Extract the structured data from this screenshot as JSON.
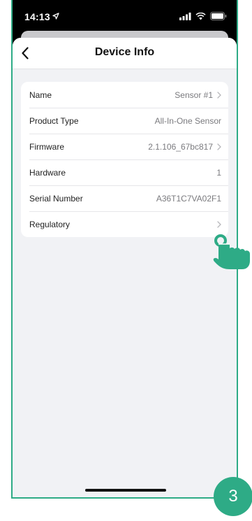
{
  "status_bar": {
    "time": "14:13"
  },
  "nav": {
    "title": "Device Info"
  },
  "rows": [
    {
      "label": "Name",
      "value": "Sensor #1",
      "chevron": true
    },
    {
      "label": "Product Type",
      "value": "All-In-One Sensor",
      "chevron": false
    },
    {
      "label": "Firmware",
      "value": "2.1.106_67bc817",
      "chevron": true
    },
    {
      "label": "Hardware",
      "value": "1",
      "chevron": false
    },
    {
      "label": "Serial Number",
      "value": "A36T1C7VA02F1",
      "chevron": false
    },
    {
      "label": "Regulatory",
      "value": "",
      "chevron": true
    }
  ],
  "step_badge": "3",
  "colors": {
    "accent": "#2eab86",
    "screen_bg": "#f1f2f5"
  }
}
